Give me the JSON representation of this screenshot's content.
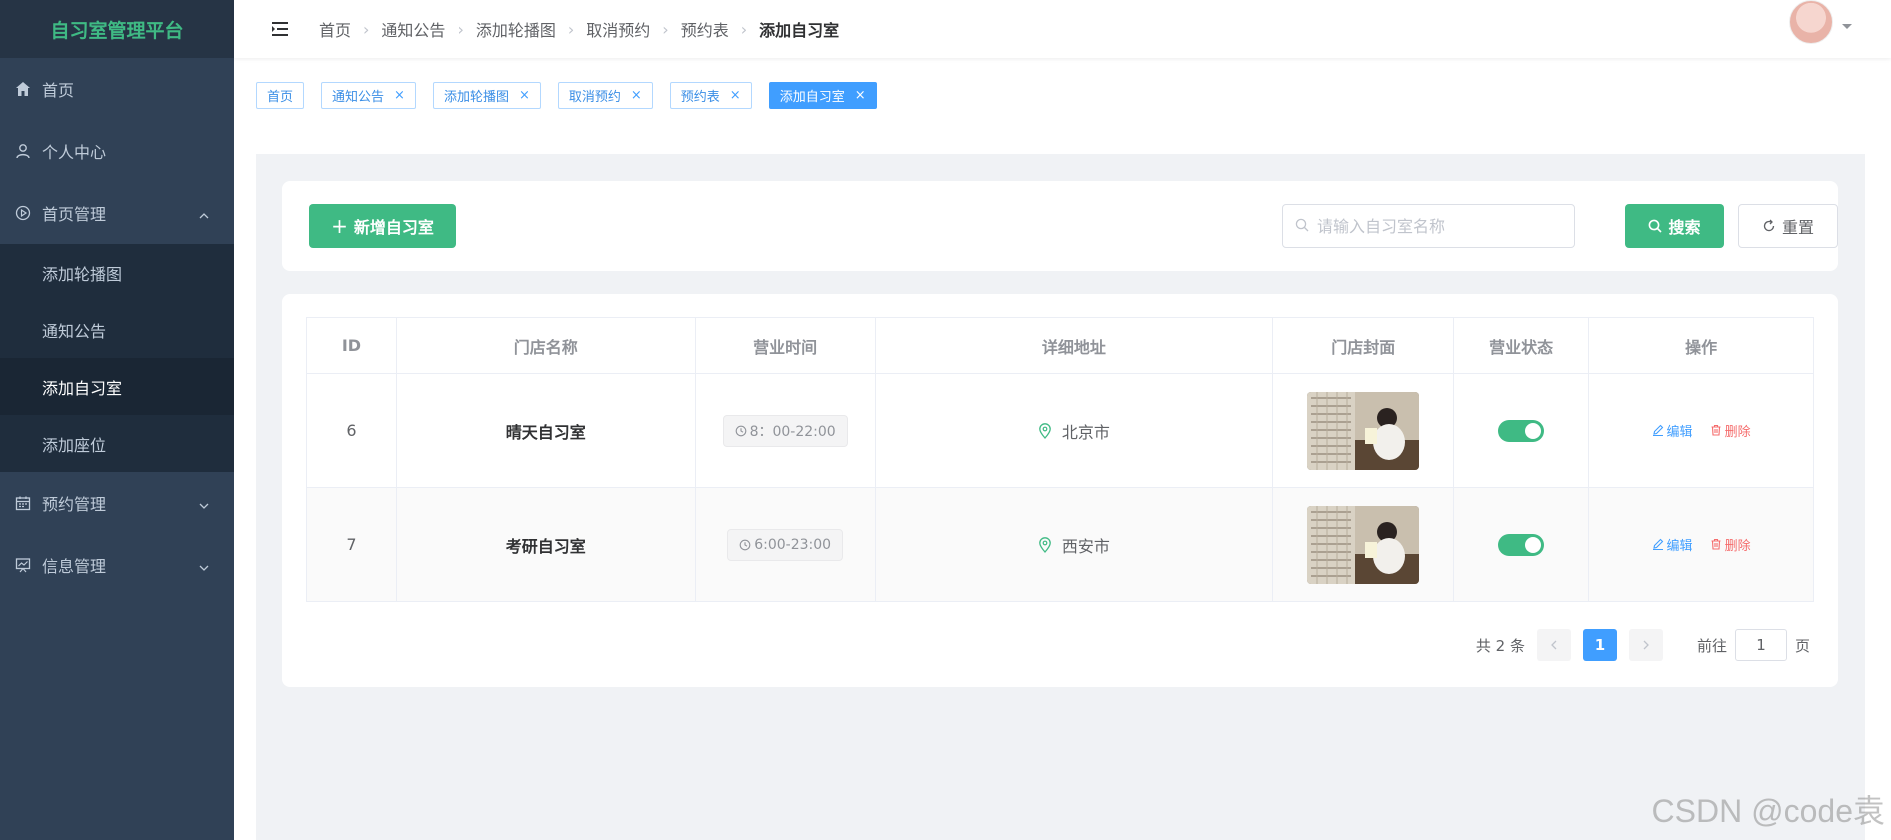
{
  "app": {
    "title": "自习室管理平台"
  },
  "sidebar": {
    "items": [
      {
        "label": "首页",
        "icon": "home-icon"
      },
      {
        "label": "个人中心",
        "icon": "user-icon"
      },
      {
        "label": "首页管理",
        "icon": "play-circle-icon",
        "expanded": true,
        "children": [
          "添加轮播图",
          "通知公告",
          "添加自习室",
          "添加座位"
        ]
      },
      {
        "label": "预约管理",
        "icon": "calendar-icon"
      },
      {
        "label": "信息管理",
        "icon": "chart-icon"
      }
    ]
  },
  "header": {
    "breadcrumb": [
      "首页",
      "通知公告",
      "添加轮播图",
      "取消预约",
      "预约表",
      "添加自习室"
    ]
  },
  "tags": [
    "首页",
    "通知公告",
    "添加轮播图",
    "取消预约",
    "预约表",
    "添加自习室"
  ],
  "toolbar": {
    "add_label": "新增自习室",
    "search_placeholder": "请输入自习室名称",
    "search_label": "搜索",
    "reset_label": "重置"
  },
  "table": {
    "columns": [
      "ID",
      "门店名称",
      "营业时间",
      "详细地址",
      "门店封面",
      "营业状态",
      "操作"
    ],
    "rows": [
      {
        "id": "6",
        "name": "晴天自习室",
        "hours": "8：00-22:00",
        "address": "北京市",
        "status": true,
        "edit": "编辑",
        "delete": "删除"
      },
      {
        "id": "7",
        "name": "考研自习室",
        "hours": "6:00-23:00",
        "address": "西安市",
        "status": true,
        "edit": "编辑",
        "delete": "删除"
      }
    ]
  },
  "pagination": {
    "total": "共 2 条",
    "current_page": "1",
    "goto_prefix": "前往",
    "goto_value": "1",
    "goto_suffix": "页"
  },
  "watermark": "CSDN @code袁",
  "colors": {
    "primary": "#3fba84",
    "sidebar": "#304156",
    "link": "#409eff",
    "danger": "#f56c6c"
  }
}
